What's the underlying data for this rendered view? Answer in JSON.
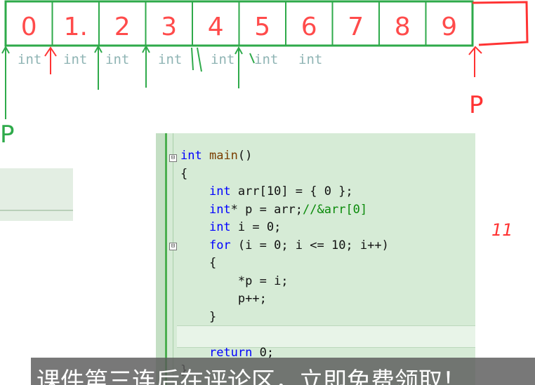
{
  "array_diagram": {
    "cells": [
      "0",
      "1.",
      "2",
      "3",
      "4",
      "5",
      "6",
      "7",
      "8",
      "9",
      ""
    ],
    "type_labels": [
      "int",
      "int",
      "int",
      "int",
      "int",
      "int",
      "int"
    ],
    "pointer_labels": [
      "P",
      "P"
    ],
    "side_note": "11"
  },
  "editor": {
    "lines": [
      {
        "indent": "",
        "parts": [
          {
            "t": "int",
            "c": "kw"
          },
          {
            "t": " ",
            "c": ""
          },
          {
            "t": "main",
            "c": "fn"
          },
          {
            "t": "()",
            "c": ""
          }
        ]
      },
      {
        "indent": "",
        "parts": [
          {
            "t": "{",
            "c": ""
          }
        ]
      },
      {
        "indent": "    ",
        "parts": [
          {
            "t": "int",
            "c": "kw"
          },
          {
            "t": " arr[10] = { 0 };",
            "c": ""
          }
        ]
      },
      {
        "indent": "    ",
        "parts": [
          {
            "t": "int",
            "c": "kw"
          },
          {
            "t": "* p = arr;",
            "c": ""
          },
          {
            "t": "//&arr[0]",
            "c": "cm"
          }
        ]
      },
      {
        "indent": "    ",
        "parts": [
          {
            "t": "int",
            "c": "kw"
          },
          {
            "t": " i = 0;",
            "c": ""
          }
        ]
      },
      {
        "indent": "    ",
        "parts": [
          {
            "t": "for",
            "c": "kw"
          },
          {
            "t": " (i = 0; i <= 10; i++)",
            "c": ""
          }
        ]
      },
      {
        "indent": "    ",
        "parts": [
          {
            "t": "{",
            "c": ""
          }
        ]
      },
      {
        "indent": "        ",
        "parts": [
          {
            "t": "*p = i;",
            "c": ""
          }
        ]
      },
      {
        "indent": "        ",
        "parts": [
          {
            "t": "p++;",
            "c": ""
          }
        ]
      },
      {
        "indent": "    ",
        "parts": [
          {
            "t": "}",
            "c": ""
          }
        ]
      },
      {
        "indent": "",
        "parts": [
          {
            "t": "",
            "c": ""
          }
        ]
      },
      {
        "indent": "    ",
        "parts": [
          {
            "t": "return",
            "c": "kw"
          },
          {
            "t": " 0;",
            "c": ""
          }
        ]
      },
      {
        "indent": "",
        "parts": [
          {
            "t": "}",
            "c": ""
          }
        ]
      }
    ],
    "fold_markers": [
      "⊟",
      "⊟"
    ]
  },
  "subtitle": {
    "text": "课件第三连后在评论区，立即免费领取！"
  },
  "colors": {
    "pen_red": "#ff3333",
    "pen_green": "#2eaa4a",
    "keyword_blue": "#0000ff",
    "comment_green": "#0a8a0a",
    "panel_green": "#d6ebd6",
    "gutter_bar": "#4caf50"
  }
}
